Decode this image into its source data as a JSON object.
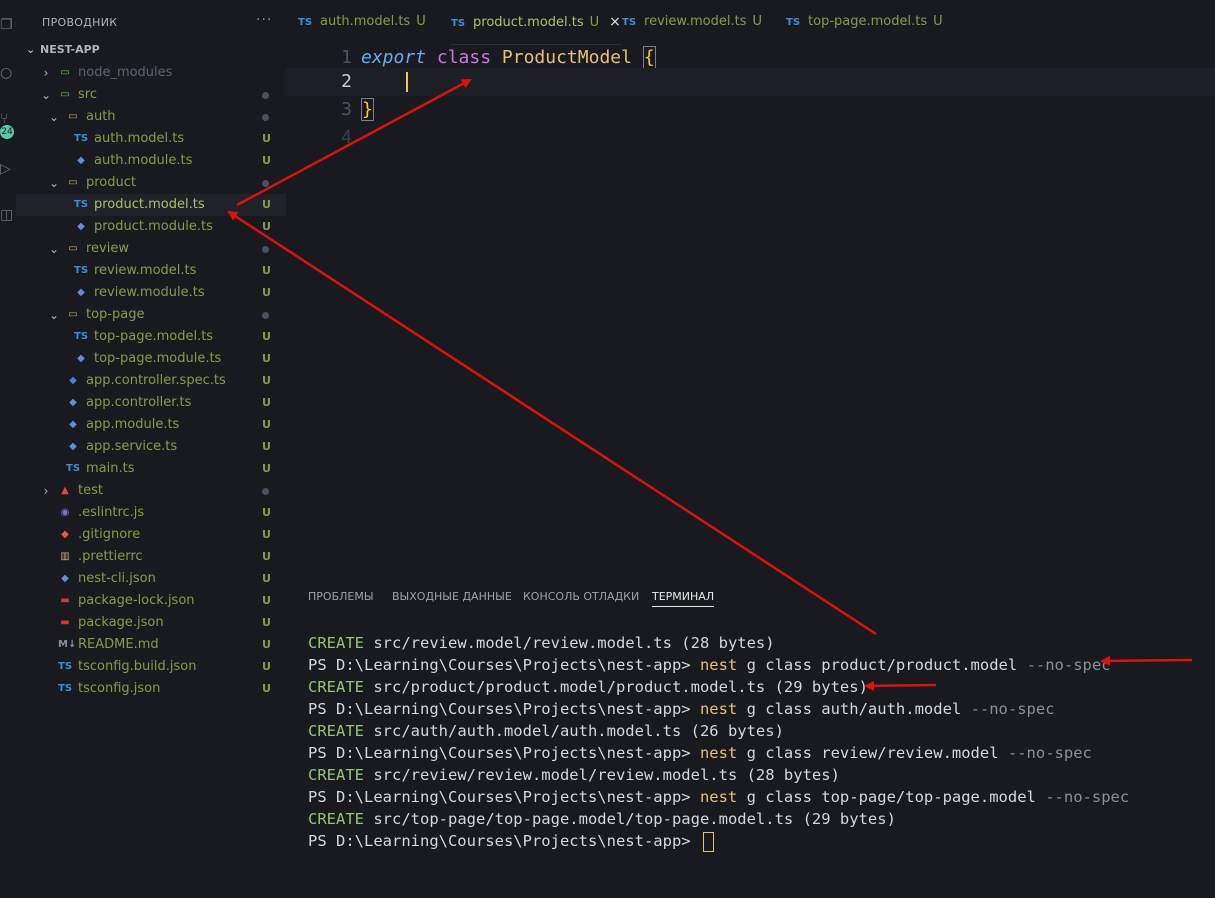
{
  "sidebar": {
    "header": "ПРОВОДНИК",
    "more": "···",
    "root": "NEST-APP",
    "badge": "24",
    "tree": [
      {
        "label": "node_modules",
        "kind": "folder",
        "state": "collapsed",
        "indent": 1,
        "icon": "node-folder-icon",
        "color": "#5a6270",
        "status": ""
      },
      {
        "label": "src",
        "kind": "folder",
        "state": "expanded",
        "indent": 1,
        "icon": "src-folder-icon",
        "color": "#8c9a4c",
        "status": "dot"
      },
      {
        "label": "auth",
        "kind": "folder",
        "state": "expanded",
        "indent": 2,
        "icon": "folder-icon",
        "color": "#8c9a4c",
        "status": "dot"
      },
      {
        "label": "auth.model.ts",
        "kind": "file",
        "indent": 3,
        "icon": "ts-icon",
        "color": "#8c9a4c",
        "status": "U"
      },
      {
        "label": "auth.module.ts",
        "kind": "file",
        "indent": 3,
        "icon": "nest-icon",
        "color": "#8c9a4c",
        "status": "U"
      },
      {
        "label": "product",
        "kind": "folder",
        "state": "expanded",
        "indent": 2,
        "icon": "folder-icon",
        "color": "#8c9a4c",
        "status": "dot"
      },
      {
        "label": "product.model.ts",
        "kind": "file",
        "indent": 3,
        "icon": "ts-icon",
        "color": "#b3bf70",
        "status": "U",
        "selected": true
      },
      {
        "label": "product.module.ts",
        "kind": "file",
        "indent": 3,
        "icon": "nest-icon",
        "color": "#8c9a4c",
        "status": "U"
      },
      {
        "label": "review",
        "kind": "folder",
        "state": "expanded",
        "indent": 2,
        "icon": "folder-icon",
        "color": "#8c9a4c",
        "status": "dot"
      },
      {
        "label": "review.model.ts",
        "kind": "file",
        "indent": 3,
        "icon": "ts-icon",
        "color": "#8c9a4c",
        "status": "U"
      },
      {
        "label": "review.module.ts",
        "kind": "file",
        "indent": 3,
        "icon": "nest-icon",
        "color": "#8c9a4c",
        "status": "U"
      },
      {
        "label": "top-page",
        "kind": "folder",
        "state": "expanded",
        "indent": 2,
        "icon": "folder-icon",
        "color": "#8c9a4c",
        "status": "dot"
      },
      {
        "label": "top-page.model.ts",
        "kind": "file",
        "indent": 3,
        "icon": "ts-icon",
        "color": "#8c9a4c",
        "status": "U"
      },
      {
        "label": "top-page.module.ts",
        "kind": "file",
        "indent": 3,
        "icon": "nest-icon",
        "color": "#8c9a4c",
        "status": "U"
      },
      {
        "label": "app.controller.spec.ts",
        "kind": "file",
        "indent": 2,
        "icon": "test-icon",
        "color": "#8c9a4c",
        "status": "U"
      },
      {
        "label": "app.controller.ts",
        "kind": "file",
        "indent": 2,
        "icon": "nest-icon",
        "color": "#8c9a4c",
        "status": "U"
      },
      {
        "label": "app.module.ts",
        "kind": "file",
        "indent": 2,
        "icon": "nest-icon",
        "color": "#8c9a4c",
        "status": "U"
      },
      {
        "label": "app.service.ts",
        "kind": "file",
        "indent": 2,
        "icon": "nest-icon",
        "color": "#8c9a4c",
        "status": "U"
      },
      {
        "label": "main.ts",
        "kind": "file",
        "indent": 2,
        "icon": "ts-icon",
        "color": "#8c9a4c",
        "status": "U"
      },
      {
        "label": "test",
        "kind": "folder",
        "state": "collapsed",
        "indent": 1,
        "icon": "test-folder-icon",
        "color": "#8c9a4c",
        "status": "dot"
      },
      {
        "label": ".eslintrc.js",
        "kind": "file",
        "indent": 1,
        "icon": "eslint-icon",
        "color": "#8c9a4c",
        "status": "U"
      },
      {
        "label": ".gitignore",
        "kind": "file",
        "indent": 1,
        "icon": "git-icon",
        "color": "#8c9a4c",
        "status": "U"
      },
      {
        "label": ".prettierrc",
        "kind": "file",
        "indent": 1,
        "icon": "prettier-icon",
        "color": "#8c9a4c",
        "status": "U"
      },
      {
        "label": "nest-cli.json",
        "kind": "file",
        "indent": 1,
        "icon": "nest-icon",
        "color": "#8c9a4c",
        "status": "U"
      },
      {
        "label": "package-lock.json",
        "kind": "file",
        "indent": 1,
        "icon": "npm-icon",
        "color": "#8c9a4c",
        "status": "U"
      },
      {
        "label": "package.json",
        "kind": "file",
        "indent": 1,
        "icon": "npm-icon",
        "color": "#8c9a4c",
        "status": "U"
      },
      {
        "label": "README.md",
        "kind": "file",
        "indent": 1,
        "icon": "markdown-icon",
        "color": "#8c9a4c",
        "status": "U"
      },
      {
        "label": "tsconfig.build.json",
        "kind": "file",
        "indent": 1,
        "icon": "tsconfig-icon",
        "color": "#8c9a4c",
        "status": "U"
      },
      {
        "label": "tsconfig.json",
        "kind": "file",
        "indent": 1,
        "icon": "tsconfig-icon",
        "color": "#8c9a4c",
        "status": "U"
      }
    ]
  },
  "tabs": [
    {
      "label": "auth.model.ts",
      "status": "U",
      "active": false
    },
    {
      "label": "product.model.ts",
      "status": "U",
      "active": true,
      "close": "×"
    },
    {
      "label": "review.model.ts",
      "status": "U",
      "active": false
    },
    {
      "label": "top-page.model.ts",
      "status": "U",
      "active": false
    }
  ],
  "tab_type_label": "TS",
  "editor": {
    "line_numbers": [
      "1",
      "2",
      "3",
      "4"
    ],
    "line1": {
      "kw1": "export",
      "kw2": "class",
      "name": "ProductModel",
      "brace": "{"
    },
    "line3": {
      "brace": "}"
    }
  },
  "panel": {
    "tabs": [
      "ПРОБЛЕМЫ",
      "ВЫХОДНЫЕ ДАННЫЕ",
      "КОНСОЛЬ ОТЛАДКИ",
      "ТЕРМИНАЛ"
    ],
    "active_tab": "ТЕРМИНАЛ",
    "terminal_lines": [
      {
        "type": "create",
        "prefix": "CREATE",
        "text": " src/review.model/review.model.ts (28 bytes)"
      },
      {
        "type": "cmd",
        "prompt": "PS D:\\Learning\\Courses\\Projects\\nest-app> ",
        "cmd": "nest",
        "args": " g class product/product.model ",
        "flag": "--no-spec"
      },
      {
        "type": "create",
        "prefix": "CREATE",
        "text": " src/product/product.model/product.model.ts (29 bytes)"
      },
      {
        "type": "cmd",
        "prompt": "PS D:\\Learning\\Courses\\Projects\\nest-app> ",
        "cmd": "nest",
        "args": " g class auth/auth.model ",
        "flag": "--no-spec"
      },
      {
        "type": "create",
        "prefix": "CREATE",
        "text": " src/auth/auth.model/auth.model.ts (26 bytes)"
      },
      {
        "type": "cmd",
        "prompt": "PS D:\\Learning\\Courses\\Projects\\nest-app> ",
        "cmd": "nest",
        "args": " g class review/review.model ",
        "flag": "--no-spec"
      },
      {
        "type": "create",
        "prefix": "CREATE",
        "text": " src/review/review.model/review.model.ts (28 bytes)"
      },
      {
        "type": "cmd",
        "prompt": "PS D:\\Learning\\Courses\\Projects\\nest-app> ",
        "cmd": "nest",
        "args": " g class top-page/top-page.model ",
        "flag": "--no-spec"
      },
      {
        "type": "create",
        "prefix": "CREATE",
        "text": " src/top-page/top-page.model/top-page.model.ts (29 bytes)"
      },
      {
        "type": "prompt",
        "prompt": "PS D:\\Learning\\Courses\\Projects\\nest-app> "
      }
    ]
  },
  "colors": {
    "background": "#181a1f",
    "untracked": "#8c9a4c",
    "annotation_arrow": "#e01010",
    "ts_blue": "#3d8fd6"
  }
}
